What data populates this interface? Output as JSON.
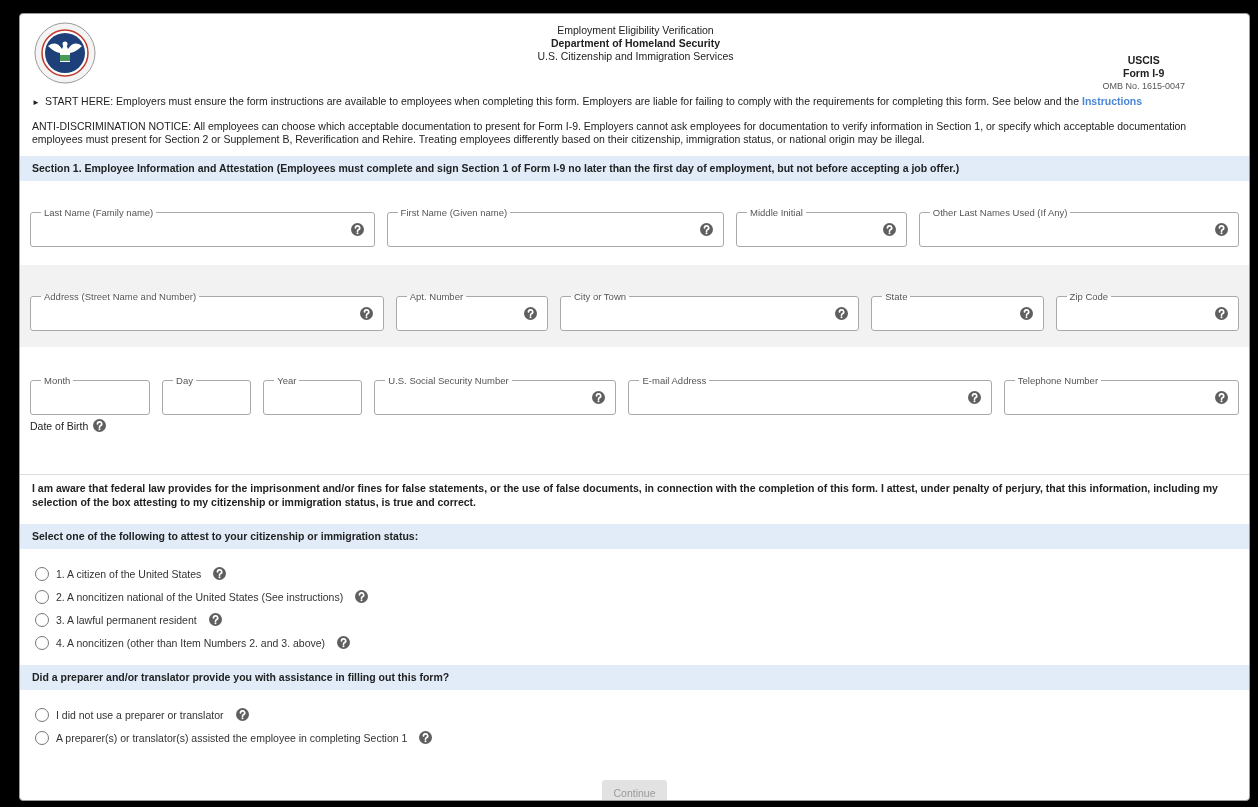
{
  "header": {
    "title": "Employment Eligibility Verification",
    "department": "Department of Homeland Security",
    "agency": "U.S. Citizenship and Immigration Services",
    "agency_short": "USCIS",
    "form_name": "Form I-9",
    "omb": "OMB No. 1615-0047"
  },
  "start_notice": {
    "marker": "►",
    "text": "START HERE: Employers must ensure the form instructions are available to employees when completing this form. Employers are liable for failing to comply with the requirements for completing this form. See below and the",
    "link": "Instructions"
  },
  "anti_discrimination": "ANTI-DISCRIMINATION NOTICE: All employees can choose which acceptable documentation to present for Form I-9. Employers cannot ask employees for documentation to verify information in Section 1, or specify which acceptable documentation employees must present for Section 2 or Supplement B, Reverification and Rehire. Treating employees differently based on their citizenship, immigration status, or national origin may be illegal.",
  "section1": {
    "heading": "Section 1. Employee Information and Attestation (Employees must complete and sign Section 1 of Form I-9 no later than the first day of employment, but not before accepting a job offer.)",
    "field_rows": [
      {
        "shaded": false,
        "fields": [
          {
            "label": "Last Name (Family name)",
            "help": true
          },
          {
            "label": "First Name (Given name)",
            "help": true
          },
          {
            "label": "Middle Initial",
            "help": true
          },
          {
            "label": "Other Last Names Used (If Any)",
            "help": true
          }
        ]
      },
      {
        "shaded": true,
        "fields": [
          {
            "label": "Address (Street Name and Number)",
            "help": true
          },
          {
            "label": "Apt. Number",
            "help": true
          },
          {
            "label": "City or Town",
            "help": true
          },
          {
            "label": "State",
            "help": true
          },
          {
            "label": "Zip Code",
            "help": true
          }
        ]
      },
      {
        "shaded": false,
        "fields": [
          {
            "label": "Month",
            "help": false
          },
          {
            "label": "Day",
            "help": false
          },
          {
            "label": "Year",
            "help": false
          },
          {
            "label": "U.S. Social Security Number",
            "help": true
          },
          {
            "label": "E-mail Address",
            "help": true
          },
          {
            "label": "Telephone Number",
            "help": true
          }
        ]
      }
    ],
    "date_of_birth": {
      "label": "Date of Birth",
      "help": true
    }
  },
  "attestation": "I am aware that federal law provides for the imprisonment and/or fines for false statements, or the use of false documents, in connection with the completion of this form. I attest, under penalty of perjury, that this information, including my selection of the box attesting to my citizenship or immigration status, is true and correct.",
  "status": {
    "heading": "Select one of the following to attest to your citizenship or immigration status:",
    "options": [
      {
        "label": "1. A citizen of the United States",
        "selected": false
      },
      {
        "label": "2. A noncitizen national of the United States (See instructions)",
        "selected": false
      },
      {
        "label": "3. A lawful permanent resident",
        "selected": false
      },
      {
        "label": "4. A noncitizen (other than Item Numbers 2. and 3. above)",
        "selected": false
      }
    ]
  },
  "preparer": {
    "heading": "Did a preparer and/or translator provide you with assistance in filling out this form?",
    "options": [
      {
        "label": "I did not use a preparer or translator",
        "selected": false
      },
      {
        "label": "A preparer(s) or translator(s) assisted the employee in completing Section 1",
        "selected": false
      }
    ]
  },
  "continue_button": {
    "label": "Continue",
    "disabled": true
  }
}
